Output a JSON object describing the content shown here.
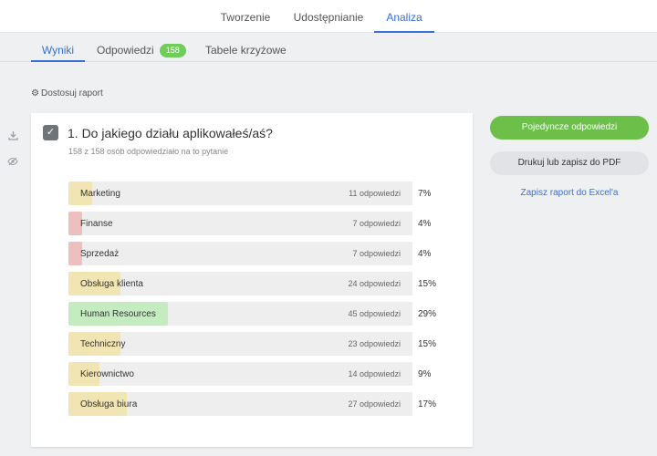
{
  "top_tabs": [
    {
      "label": "Tworzenie"
    },
    {
      "label": "Udostępnianie"
    },
    {
      "label": "Analiza"
    }
  ],
  "active_top_tab": "Analiza",
  "sub_tabs": [
    {
      "label": "Wyniki"
    },
    {
      "label": "Odpowiedzi",
      "badge": "158"
    },
    {
      "label": "Tabele krzyżowe"
    }
  ],
  "active_sub_tab": "Wyniki",
  "customize_label": "Dostosuj raport",
  "side_icons": [
    "download-icon",
    "eye-off-icon"
  ],
  "question": {
    "title": "1. Do jakiego działu aplikowałeś/aś?",
    "subtitle": "158 z 158 osób odpowiedziało na to pytanie",
    "answers": [
      {
        "label": "Marketing",
        "count": "11 odpowiedzi",
        "percent": "7%",
        "share": 0.07,
        "color": "#f1e6b3"
      },
      {
        "label": "Finanse",
        "count": "7 odpowiedzi",
        "percent": "4%",
        "share": 0.04,
        "color": "#eebfbf"
      },
      {
        "label": "Sprzedaż",
        "count": "7 odpowiedzi",
        "percent": "4%",
        "share": 0.04,
        "color": "#eebfbf"
      },
      {
        "label": "Obsługa klienta",
        "count": "24 odpowiedzi",
        "percent": "15%",
        "share": 0.15,
        "color": "#f1e6b3"
      },
      {
        "label": "Human Resources",
        "count": "45 odpowiedzi",
        "percent": "29%",
        "share": 0.29,
        "color": "#c4ecc0"
      },
      {
        "label": "Techniczny",
        "count": "23 odpowiedzi",
        "percent": "15%",
        "share": 0.15,
        "color": "#f1e6b3"
      },
      {
        "label": "Kierownictwo",
        "count": "14 odpowiedzi",
        "percent": "9%",
        "share": 0.09,
        "color": "#f1e6b3"
      },
      {
        "label": "Obsługa biura",
        "count": "27 odpowiedzi",
        "percent": "17%",
        "share": 0.17,
        "color": "#f1e6b3"
      }
    ]
  },
  "actions": {
    "single_responses": "Pojedyncze odpowiedzi",
    "print_pdf": "Drukuj lub zapisz do PDF",
    "excel": "Zapisz raport do Excel'a"
  },
  "colors": {
    "accent": "#3a6fd8",
    "primary_button": "#6cc04a",
    "badge": "#6fcd59"
  }
}
